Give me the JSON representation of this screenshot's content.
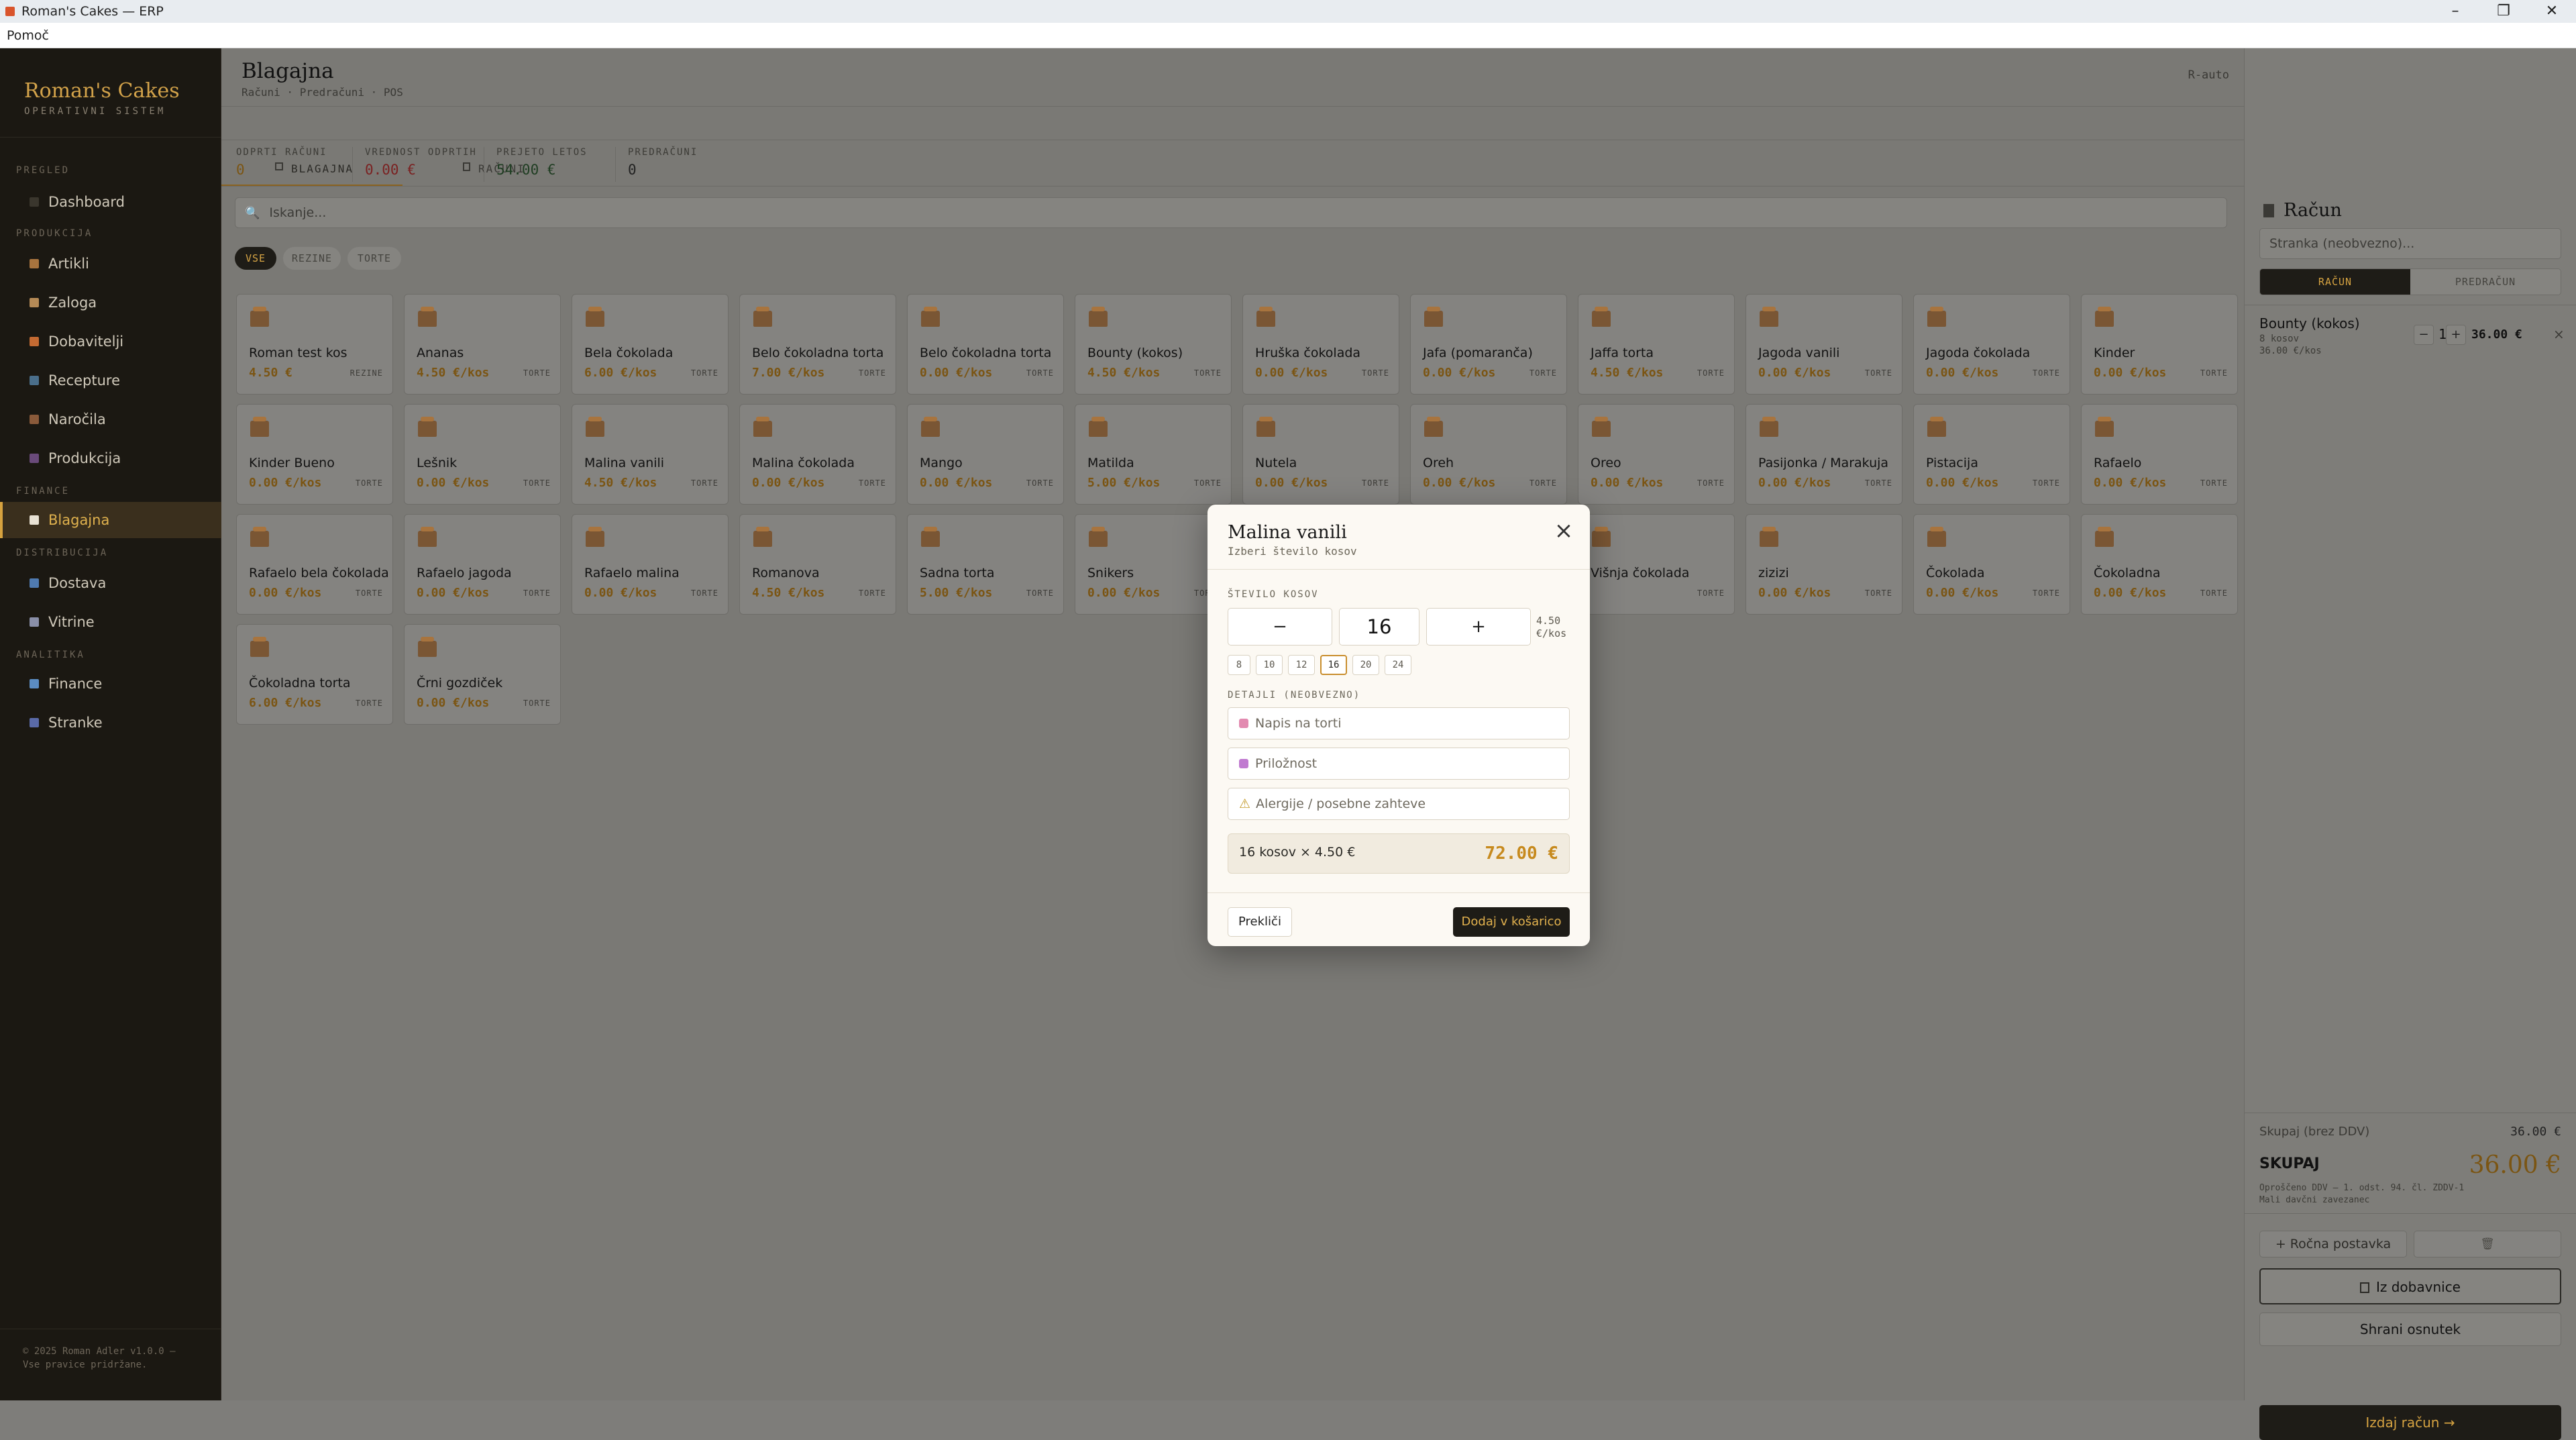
{
  "window": {
    "title": "Roman's Cakes — ERP",
    "menu": "Pomoč"
  },
  "sidebar": {
    "brand": "Roman's Cakes",
    "brand_sub": "OPERATIVNI SISTEM",
    "sections": {
      "pregled": "PREGLED",
      "produkcija": "PRODUKCIJA",
      "finance": "FINANCE",
      "distribucija": "DISTRIBUCIJA",
      "analitika": "ANALITIKA"
    },
    "items": {
      "dashboard": "Dashboard",
      "artikli": "Artikli",
      "zaloga": "Zaloga",
      "dobavitelji": "Dobavitelji",
      "recepture": "Recepture",
      "narocila": "Naročila",
      "produkcija": "Produkcija",
      "blagajna": "Blagajna",
      "dostava": "Dostava",
      "vitrine": "Vitrine",
      "finance": "Finance",
      "stranke": "Stranke"
    },
    "footer": "© 2025 Roman Adler v1.0.0 — Vse pravice pridržane."
  },
  "header": {
    "title": "Blagajna",
    "breadcrumb": "Računi · Predračuni · POS",
    "right": "R-auto"
  },
  "tabs": {
    "blagajna": "BLAGAJNA",
    "racuni": "RAČUNI"
  },
  "stats": [
    {
      "label": "ODPRTI RAČUNI",
      "value": "0"
    },
    {
      "label": "VREDNOST ODPRTIH",
      "value": "0.00 €"
    },
    {
      "label": "PREJETO LETOS",
      "value": "54.00 €"
    },
    {
      "label": "PREDRAČUNI",
      "value": "0"
    }
  ],
  "search": {
    "placeholder": "Iskanje..."
  },
  "filters": {
    "all": "VSE",
    "rezine": "REZINE",
    "torte": "TORTE"
  },
  "products": [
    {
      "name": "Roman test kos",
      "price": "4.50 €",
      "cat": "REZINE"
    },
    {
      "name": "Ananas",
      "price": "4.50 €/kos",
      "cat": "TORTE"
    },
    {
      "name": "Bela čokolada",
      "price": "6.00 €/kos",
      "cat": "TORTE"
    },
    {
      "name": "Belo čokoladna torta",
      "price": "7.00 €/kos",
      "cat": "TORTE"
    },
    {
      "name": "Belo čokoladna torta",
      "price": "0.00 €/kos",
      "cat": "TORTE"
    },
    {
      "name": "Bounty (kokos)",
      "price": "4.50 €/kos",
      "cat": "TORTE"
    },
    {
      "name": "Hruška čokolada",
      "price": "0.00 €/kos",
      "cat": "TORTE"
    },
    {
      "name": "Jafa (pomaranča)",
      "price": "0.00 €/kos",
      "cat": "TORTE"
    },
    {
      "name": "Jaffa torta",
      "price": "4.50 €/kos",
      "cat": "TORTE"
    },
    {
      "name": "Jagoda vanili",
      "price": "0.00 €/kos",
      "cat": "TORTE"
    },
    {
      "name": "Jagoda čokolada",
      "price": "0.00 €/kos",
      "cat": "TORTE"
    },
    {
      "name": "Kinder",
      "price": "0.00 €/kos",
      "cat": "TORTE"
    },
    {
      "name": "Kinder Bueno",
      "price": "0.00 €/kos",
      "cat": "TORTE"
    },
    {
      "name": "Lešnik",
      "price": "0.00 €/kos",
      "cat": "TORTE"
    },
    {
      "name": "Malina vanili",
      "price": "4.50 €/kos",
      "cat": "TORTE"
    },
    {
      "name": "Malina čokolada",
      "price": "0.00 €/kos",
      "cat": "TORTE"
    },
    {
      "name": "Mango",
      "price": "0.00 €/kos",
      "cat": "TORTE"
    },
    {
      "name": "Matilda",
      "price": "5.00 €/kos",
      "cat": "TORTE"
    },
    {
      "name": "Nutela",
      "price": "0.00 €/kos",
      "cat": "TORTE"
    },
    {
      "name": "Oreh",
      "price": "0.00 €/kos",
      "cat": "TORTE"
    },
    {
      "name": "Oreo",
      "price": "0.00 €/kos",
      "cat": "TORTE"
    },
    {
      "name": "Pasijonka / Marakuja",
      "price": "0.00 €/kos",
      "cat": "TORTE"
    },
    {
      "name": "Pistacija",
      "price": "0.00 €/kos",
      "cat": "TORTE"
    },
    {
      "name": "Rafaelo",
      "price": "0.00 €/kos",
      "cat": "TORTE"
    },
    {
      "name": "Rafaelo bela čokolada",
      "price": "0.00 €/kos",
      "cat": "TORTE"
    },
    {
      "name": "Rafaelo jagoda",
      "price": "0.00 €/kos",
      "cat": "TORTE"
    },
    {
      "name": "Rafaelo malina",
      "price": "0.00 €/kos",
      "cat": "TORTE"
    },
    {
      "name": "Romanova",
      "price": "4.50 €/kos",
      "cat": "TORTE"
    },
    {
      "name": "Sadna torta",
      "price": "5.00 €/kos",
      "cat": "TORTE"
    },
    {
      "name": "Snikers",
      "price": "0.00 €/kos",
      "cat": "TORTE"
    },
    {
      "name": "",
      "price": "",
      "cat": ""
    },
    {
      "name": "",
      "price": "",
      "cat": ""
    },
    {
      "name": "Višnja čokolada",
      "price": "",
      "cat": "TORTE"
    },
    {
      "name": "zizizi",
      "price": "0.00 €/kos",
      "cat": "TORTE"
    },
    {
      "name": "Čokolada",
      "price": "0.00 €/kos",
      "cat": "TORTE"
    },
    {
      "name": "Čokoladna",
      "price": "0.00 €/kos",
      "cat": "TORTE"
    },
    {
      "name": "Čokoladna torta",
      "price": "6.00 €/kos",
      "cat": "TORTE"
    },
    {
      "name": "Črni gozdiček",
      "price": "0.00 €/kos",
      "cat": "TORTE"
    }
  ],
  "panel": {
    "title": "Račun",
    "customer_placeholder": "Stranka (neobvezno)...",
    "seg_racun": "RAČUN",
    "seg_predracun": "PREDRAČUN",
    "cart": [
      {
        "name": "Bounty (kokos)",
        "sub1": "8 kosov",
        "sub2": "36.00 €/kos",
        "qty": "1",
        "total": "36.00 €"
      }
    ],
    "subtotal_label": "Skupaj (brez DDV)",
    "subtotal_value": "36.00 €",
    "total_label": "SKUPAJ",
    "total_value": "36.00 €",
    "note1": "Oproščeno DDV — 1. odst. 94. čl. ZDDV-1",
    "note2": "Mali davčni zavezanec",
    "manual": "+ Ročna postavka",
    "from_supplier": "Iz dobavnice",
    "save_draft": "Shrani osnutek",
    "issue": "Izdaj račun →"
  },
  "modal": {
    "title": "Malina vanili",
    "subtitle": "Izberi število kosov",
    "qty_label": "ŠTEVILO KOSOV",
    "minus": "−",
    "qty": "16",
    "plus": "+",
    "unit_price": "4.50 €/kos",
    "presets": [
      "8",
      "10",
      "12",
      "16",
      "20",
      "24"
    ],
    "details_label": "DETAJLI (NEOBVEZNO)",
    "inscription_placeholder": "Napis na torti",
    "occasion_placeholder": "Priložnost",
    "allergy_placeholder": "Alergije / posebne zahteve",
    "total_label": "16 kosov × 4.50 €",
    "total_value": "72.00 €",
    "cancel": "Prekliči",
    "add": "Dodaj v košarico"
  },
  "colors": {
    "accent": "#d6a23f",
    "dark": "#1e1c17",
    "price": "#c78a1e"
  }
}
